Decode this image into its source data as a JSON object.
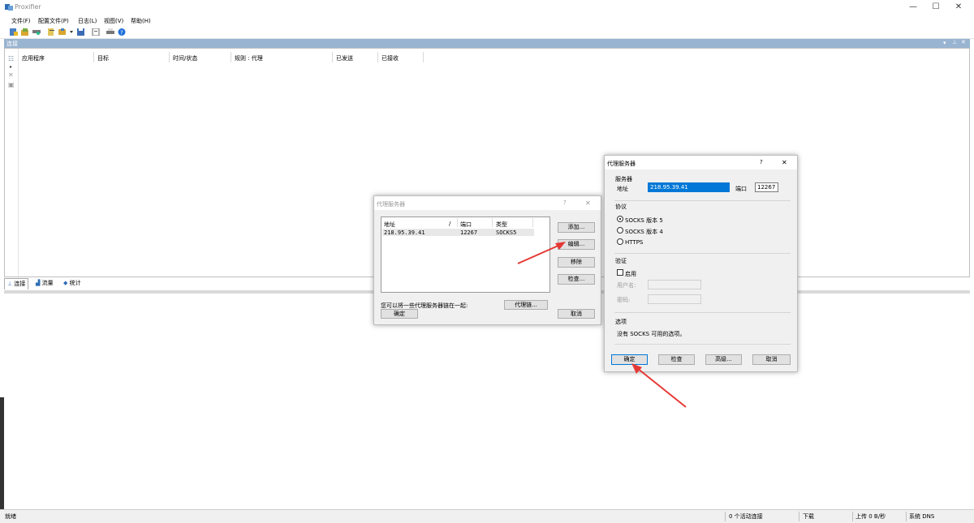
{
  "window": {
    "title": "Proxifier",
    "minimize": "—",
    "maximize": "☐",
    "close": "✕"
  },
  "menu": [
    "文件(F)",
    "配置文件(P)",
    "日志(L)",
    "视图(V)",
    "帮助(H)"
  ],
  "connections": {
    "header": "连接",
    "columns": [
      "应用程序",
      "目标",
      "时间/状态",
      "规则 : 代理",
      "已发送",
      "已接收"
    ]
  },
  "tabs": [
    "连接",
    "流量",
    "统计"
  ],
  "statusbar": {
    "ready": "就绪",
    "active": "0 个活动连接",
    "down": "下载",
    "up": "上传 0 B/秒",
    "dns": "系统 DNS"
  },
  "proxy_list_dialog": {
    "title": "代理服务器",
    "help": "?",
    "close": "✕",
    "columns": {
      "address": "地址",
      "sort": "/",
      "port": "端口",
      "type": "类型"
    },
    "rows": [
      {
        "address": "218.95.39.41",
        "port": "12267",
        "type": "SOCKS5"
      }
    ],
    "buttons": {
      "add": "添加...",
      "edit": "编辑...",
      "remove": "移除",
      "check": "检查...",
      "chain": "代理链...",
      "ok": "确定",
      "cancel": "取消"
    },
    "note": "您可以将一些代理服务器链在一起:"
  },
  "proxy_edit_dialog": {
    "title": "代理服务器",
    "help": "?",
    "close": "✕",
    "server_group": "服务器",
    "address_label": "地址",
    "address_value": "218.95.39.41",
    "port_label": "端口",
    "port_value": "12267",
    "protocol_group": "协议",
    "protocols": [
      "SOCKS 版本 5",
      "SOCKS 版本 4",
      "HTTPS"
    ],
    "selected_protocol": "SOCKS 版本 5",
    "auth_group": "验证",
    "enable_label": "启用",
    "username_label": "用户名:",
    "password_label": "密码:",
    "options_group": "选项",
    "options_text": "没有 SOCKS 可用的选项。",
    "buttons": {
      "ok": "确定",
      "check": "检查",
      "advanced": "高级...",
      "cancel": "取消"
    }
  },
  "colors": {
    "header_blue": "#99b4d1",
    "arrow_red": "#e53935",
    "selection_blue": "#0078d7"
  },
  "icons": [
    "proxifier-app-icon",
    "new-profile-icon",
    "open-icon",
    "save-icon",
    "settings-icon",
    "print-icon",
    "help-icon"
  ]
}
